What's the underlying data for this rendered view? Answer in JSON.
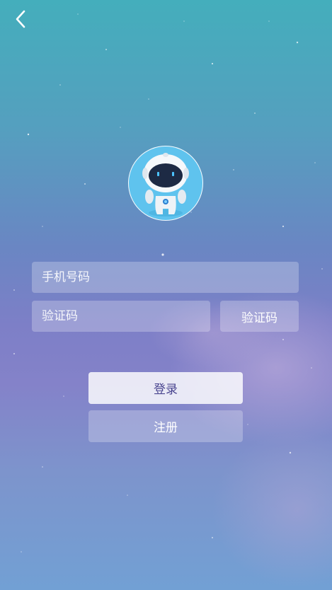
{
  "header": {
    "back_icon": "chevron-left-icon"
  },
  "avatar": {
    "icon": "robot-mascot-icon"
  },
  "form": {
    "phone_placeholder": "手机号码",
    "code_placeholder": "验证码",
    "get_code_label": "验证码"
  },
  "actions": {
    "login_label": "登录",
    "register_label": "注册"
  },
  "colors": {
    "background_top": "#44aebc",
    "background_mid": "#7d7fc7",
    "background_bottom": "#72a0d4",
    "login_text": "#4a4590",
    "avatar_bg": "#5fc3ee"
  }
}
